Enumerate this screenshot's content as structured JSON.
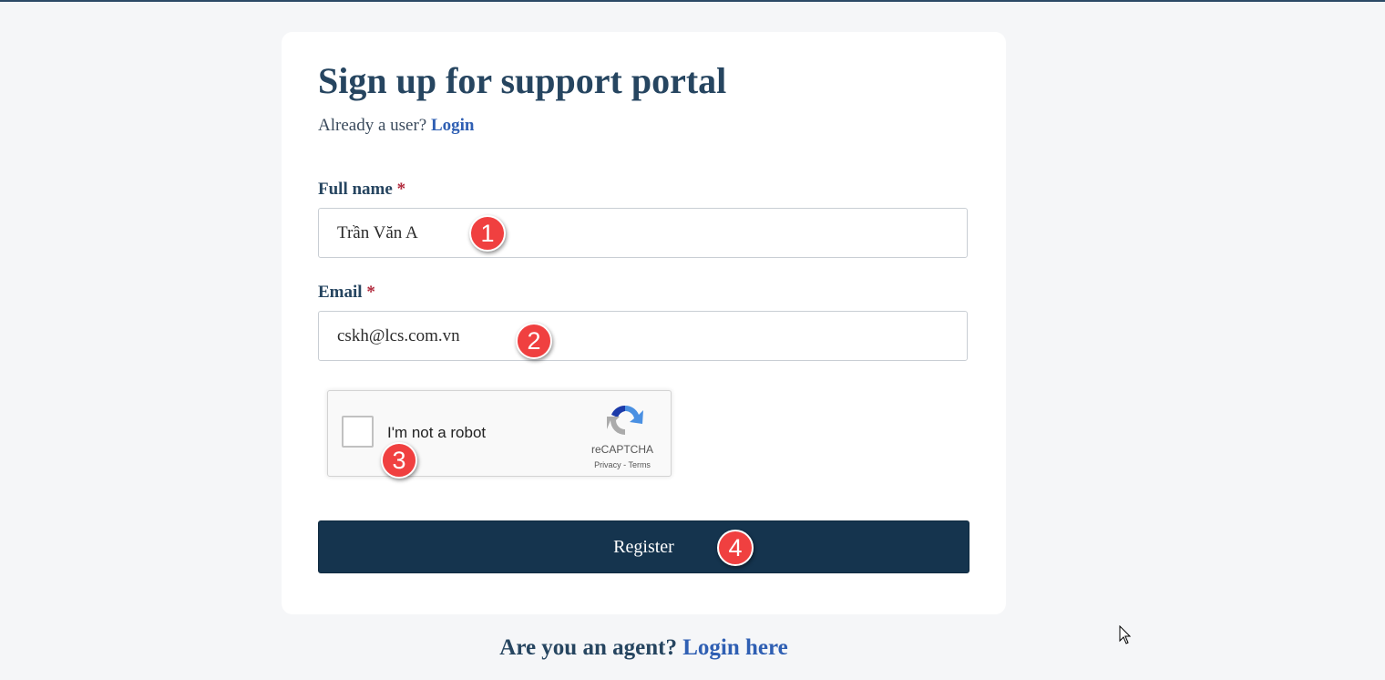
{
  "page": {
    "title": "Sign up for support portal",
    "already_user_text": "Already a user?",
    "login_link": "Login"
  },
  "form": {
    "full_name": {
      "label": "Full name",
      "required_mark": "*",
      "value": "Trần Văn A"
    },
    "email": {
      "label": "Email",
      "required_mark": "*",
      "value": "cskh@lcs.com.vn"
    },
    "recaptcha": {
      "label": "I'm not a robot",
      "brand": "reCAPTCHA",
      "privacy": "Privacy",
      "separator": "-",
      "terms": "Terms",
      "checked": false
    },
    "register_label": "Register"
  },
  "footer": {
    "agent_text": "Are you an agent?",
    "agent_login_link": "Login here"
  },
  "annotations": [
    {
      "number": "1"
    },
    {
      "number": "2"
    },
    {
      "number": "3"
    },
    {
      "number": "4"
    }
  ],
  "colors": {
    "background": "#f5f6f8",
    "heading": "#264560",
    "link": "#2f5fb3",
    "required": "#b0273a",
    "button": "#15344e",
    "badge": "#f04040"
  }
}
